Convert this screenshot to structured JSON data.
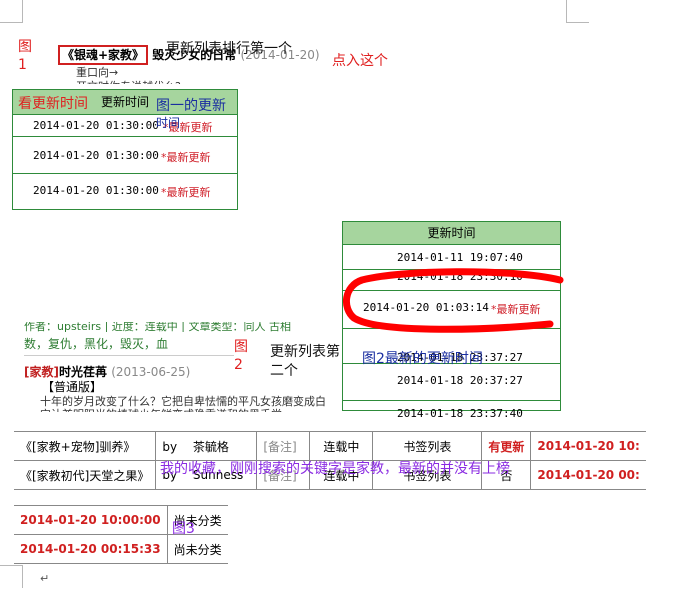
{
  "fig1": {
    "label": "图1",
    "title_badge": "《银魂+家教》",
    "title_rest": "毁灭少女的日常",
    "title_date": "(2014-01-20)",
    "line2": "重口向→",
    "line3": "开文时你专说越代么?",
    "annot_first": "更新列表排行第一个",
    "annot_click": "点入这个"
  },
  "table1": {
    "header": "更新时间",
    "annot_see": "看更新时间",
    "annot_fig1": "图一的更新",
    "annot_time": "时间",
    "rows": [
      {
        "time": "2014-01-20 01:30:00",
        "flag": "*最新更新"
      },
      {
        "time": "2014-01-20 01:30:00",
        "flag": "*最新更新"
      },
      {
        "time": "2014-01-20 01:30:00",
        "flag": "*最新更新"
      }
    ]
  },
  "table2": {
    "header": "更新时间",
    "rows": [
      {
        "time": "2014-01-11 19:07:40",
        "flag": ""
      },
      {
        "time": "2014-01-18 23:30:10",
        "flag": ""
      },
      {
        "time": "2014-01-20 01:03:14",
        "flag": "*最新更新"
      },
      {
        "time": "2014-01-18 23:37:27",
        "flag": ""
      },
      {
        "time": "2014-01-18 20:37:27",
        "flag": ""
      },
      {
        "time": "2014-01-18 23:37:40",
        "flag": ""
      }
    ],
    "annot": "图2最新的更新时间",
    "highlight_color": "#ff0000"
  },
  "fig2": {
    "label": "图2",
    "annot_list": "更新列表第二个",
    "tags_line1": "作者：upsteirs | 近度：连载中 | 文章类型：同人 古相",
    "tags_line2": "数，复仇，黑化，毁灭，血",
    "title_badge": "[家教]",
    "title_rest": "时光荏苒",
    "title_date": "(2013-06-25)",
    "version": "【普通版】",
    "desc1": "十年的岁月改变了什么？它把自卑怯懦的平凡女孩磨变成白",
    "desc2": "它让兼明阳光的棒球少年鲜变成稳重谦和的黑手党..."
  },
  "table3": {
    "rows": [
      {
        "title": "《[家教+宠物]驯养》",
        "by": "by",
        "author": "茶毓格",
        "note": "[备注]",
        "status": "连载中",
        "bookmark": "书签列表",
        "updated": "有更新",
        "time": "2014-01-20 10:"
      },
      {
        "title": "《[家教初代]天堂之果》",
        "by": "by",
        "author": "Sunness",
        "note": "[备注]",
        "status": "连载中",
        "bookmark": "书签列表",
        "updated": "否",
        "time": "2014-01-20 00:"
      }
    ],
    "annot": "我的收藏，刚刚搜索的关键字是家教，最新的并没有上榜"
  },
  "table4": {
    "rows": [
      {
        "time": "2014-01-20 10:00:00",
        "category": "尚未分类"
      },
      {
        "time": "2014-01-20 00:15:33",
        "category": "尚未分类"
      }
    ],
    "annot": "图3"
  },
  "colors": {
    "red": "#e02020",
    "green_header": "#a6d59e",
    "green_border": "#2e8b3a",
    "annot_blue": "#1a2ea0",
    "annot_purple": "#8a2be2"
  }
}
